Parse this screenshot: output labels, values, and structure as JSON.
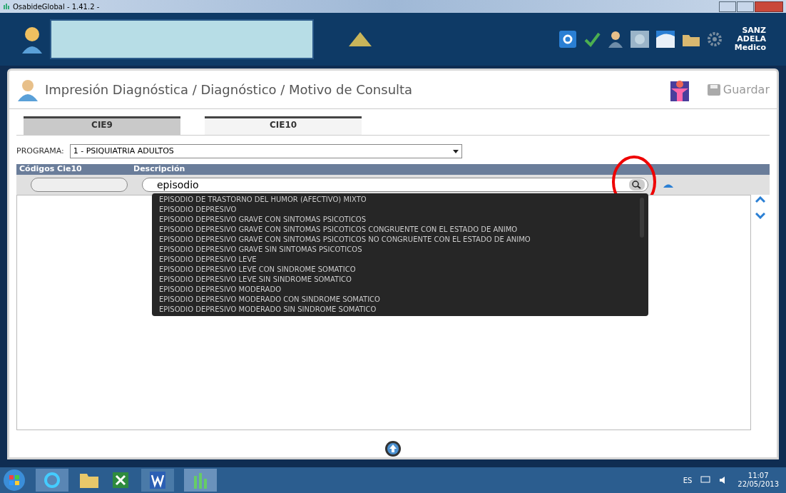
{
  "window": {
    "title": "OsabideGlobal - 1.41.2 -"
  },
  "user": {
    "lines": [
      "SANZ",
      "ADELA",
      "Medico"
    ]
  },
  "panel": {
    "title": "Impresión Diagnóstica / Diagnóstico / Motivo de Consulta",
    "save_label": "Guardar"
  },
  "tabs": [
    {
      "label": "CIE9",
      "selected": false
    },
    {
      "label": "CIE10",
      "selected": true
    }
  ],
  "programa": {
    "label": "PROGRAMA:",
    "value": "1 - PSIQUIATRIA ADULTOS"
  },
  "columns": [
    "Códigos Cie10",
    "Descripción"
  ],
  "filters": {
    "description": "episodio"
  },
  "suggestions": [
    "EPISODIO DE TRASTORNO DEL HUMOR (AFECTIVO) MIXTO",
    "EPISODIO DEPRESIVO",
    "EPISODIO DEPRESIVO GRAVE CON SINTOMAS PSICOTICOS",
    "EPISODIO DEPRESIVO GRAVE CON SINTOMAS PSICOTICOS CONGRUENTE CON EL ESTADO DE ANIMO",
    "EPISODIO DEPRESIVO GRAVE CON SINTOMAS PSICOTICOS NO CONGRUENTE CON EL ESTADO DE ANIMO",
    "EPISODIO DEPRESIVO GRAVE SIN SINTOMAS PSICOTICOS",
    "EPISODIO DEPRESIVO LEVE",
    "EPISODIO DEPRESIVO LEVE CON SINDROME SOMATICO",
    "EPISODIO DEPRESIVO LEVE SIN SINDROME SOMATICO",
    "EPISODIO DEPRESIVO MODERADO",
    "EPISODIO DEPRESIVO MODERADO CON SINDROME SOMATICO",
    "EPISODIO DEPRESIVO MODERADO SIN SINDROME SOMATICO"
  ],
  "taskbar": {
    "language": "ES",
    "time": "11:07",
    "date": "22/05/2013"
  }
}
